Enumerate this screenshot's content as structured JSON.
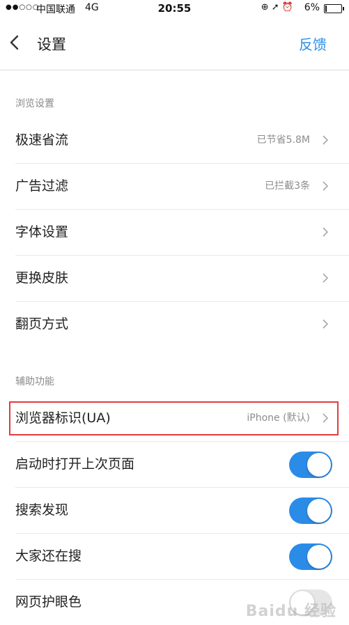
{
  "status_bar": {
    "signal": "●●○○○",
    "carrier": "中国联通",
    "network": "4G",
    "time": "20:55",
    "icons": "⊕ ➚ ⏰",
    "battery": "6%"
  },
  "header": {
    "title": "设置",
    "feedback": "反馈"
  },
  "sections": [
    {
      "title": "浏览设置",
      "items": [
        {
          "label": "极速省流",
          "value": "已节省5.8M"
        },
        {
          "label": "广告过滤",
          "value": "已拦截3条"
        },
        {
          "label": "字体设置",
          "value": ""
        },
        {
          "label": "更换皮肤",
          "value": ""
        },
        {
          "label": "翻页方式",
          "value": ""
        }
      ]
    },
    {
      "title": "辅助功能",
      "items": [
        {
          "label": "浏览器标识(UA)",
          "value": "iPhone (默认)",
          "highlighted": true
        },
        {
          "label": "启动时打开上次页面",
          "toggle": "on"
        },
        {
          "label": "搜索发现",
          "toggle": "on"
        },
        {
          "label": "大家还在搜",
          "toggle": "on"
        },
        {
          "label": "网页护眼色",
          "toggle": "off"
        }
      ]
    }
  ],
  "watermark": "Baidu 经验",
  "colors": {
    "accent": "#2a8ee8",
    "toggle_on": "#2b8ce8",
    "highlight": "#e23b3b"
  }
}
